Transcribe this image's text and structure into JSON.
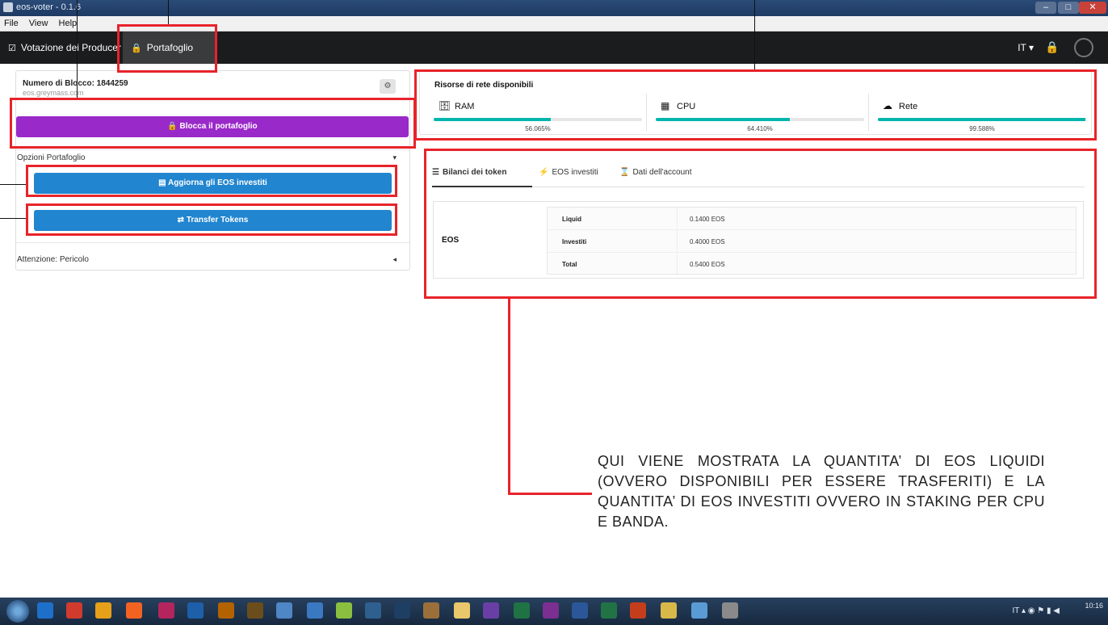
{
  "window": {
    "title": "eos-voter - 0.1.6"
  },
  "menu": [
    "File",
    "View",
    "Help"
  ],
  "nav": {
    "producers_label": "Votazione dei Producer",
    "wallet_label": "Portafoglio",
    "language": "IT"
  },
  "left": {
    "block_label": "Numero di Blocco: 1844259",
    "server": "eos.greymass.com",
    "lock_wallet": "Blocca il portafoglio",
    "wallet_options": "Opzioni Portafoglio",
    "update_stake": "Aggiorna gli EOS investiti",
    "transfer": "Transfer Tokens",
    "danger": "Attenzione: Pericolo"
  },
  "resources": {
    "title": "Risorse di rete disponibili",
    "items": [
      {
        "name": "RAM",
        "icon": "database-icon",
        "percent_text": "56.065%",
        "fill": 0.56065
      },
      {
        "name": "CPU",
        "icon": "chip-icon",
        "percent_text": "64.410%",
        "fill": 0.6441
      },
      {
        "name": "Rete",
        "icon": "cloud-icon",
        "percent_text": "99.588%",
        "fill": 0.99588
      }
    ]
  },
  "tabs": [
    "Bilanci dei token",
    "EOS investiti",
    "Dati dell'account"
  ],
  "balances": {
    "token": "EOS",
    "rows": [
      {
        "key": "Liquid",
        "value": "0.1400 EOS"
      },
      {
        "key": "Investiti",
        "value": "0.4000 EOS"
      },
      {
        "key": "Total",
        "value": "0.5400 EOS"
      }
    ]
  },
  "annotation": "QUI VIENE MOSTRATA LA QUANTITA’ DI EOS LIQUIDI (OVVERO DISPONIBILI PER ESSERE TRASFERITI) E LA QUANTITA’ DI EOS INVESTITI OVVERO IN STAKING PER CPU E BANDA.",
  "taskbar": {
    "lang": "IT",
    "time": "10:16"
  },
  "colors": {
    "accent_purple": "#9a29c9",
    "accent_blue": "#2185d0",
    "teal": "#00b5ad",
    "annotation_red": "#e8232a"
  }
}
